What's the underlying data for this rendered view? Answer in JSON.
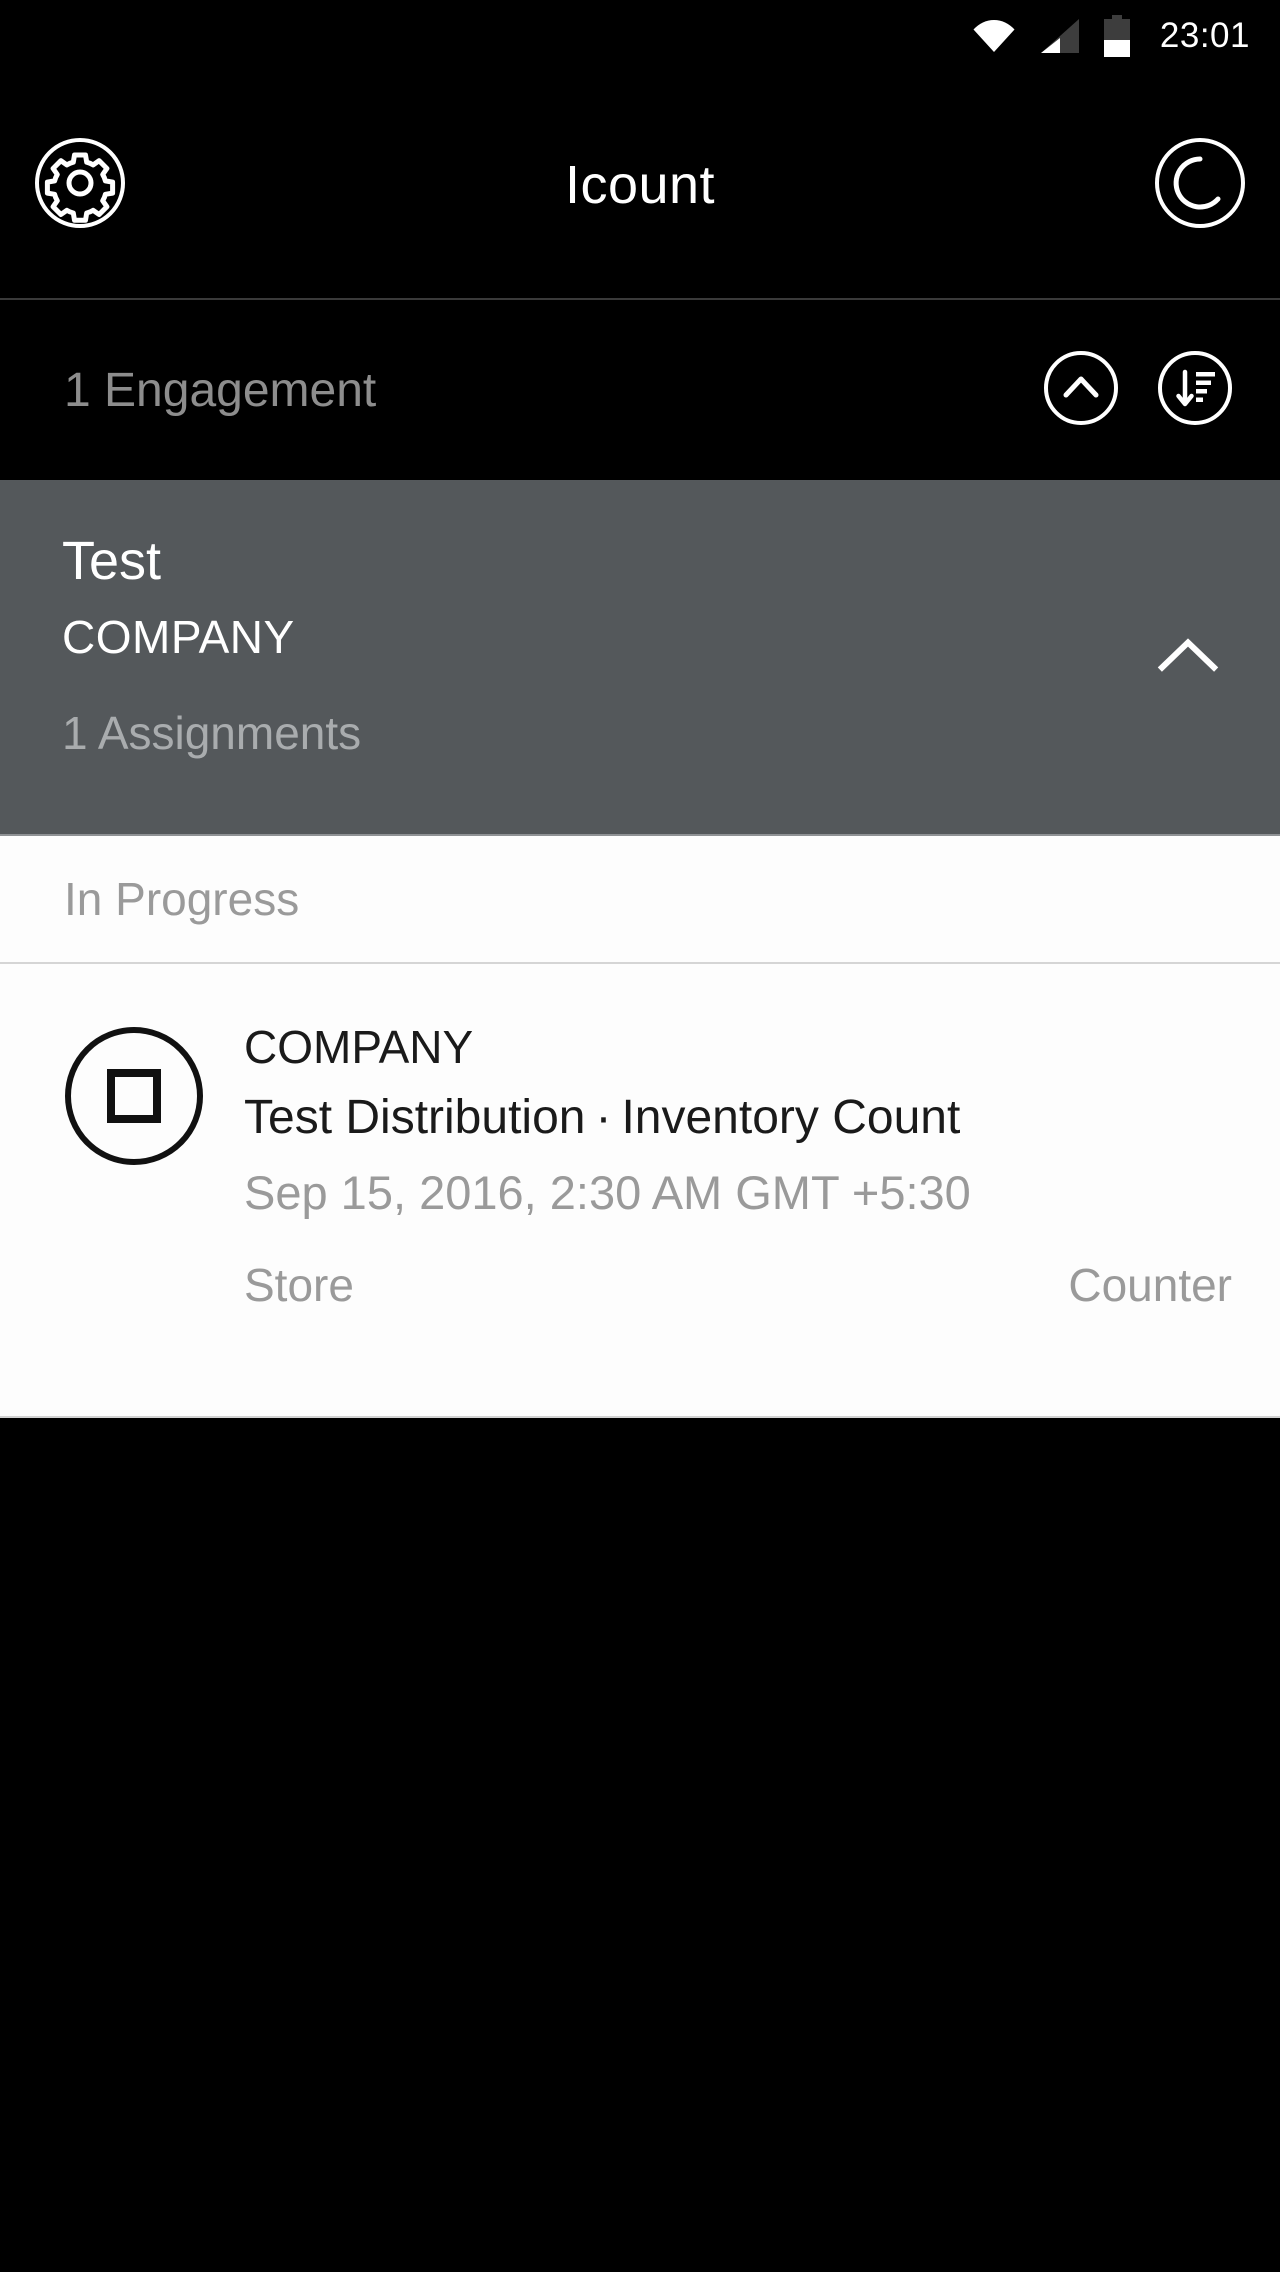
{
  "statusbar": {
    "time": "23:01",
    "icons": [
      "wifi-icon",
      "cellular-signal-icon",
      "battery-icon"
    ],
    "battery_level_percent": 45
  },
  "appbar": {
    "title": "Icount",
    "settings_icon": "gear-icon",
    "sync_icon": "sync-refresh-icon"
  },
  "engagement_header": {
    "count_label": "1 Engagement",
    "collapse_icon": "chevron-up-circle-icon",
    "sort_icon": "sort-descending-icon"
  },
  "engagement_card": {
    "title": "Test",
    "subtitle": "COMPANY",
    "assignments_label": "1 Assignments",
    "expand_icon": "chevron-up-icon",
    "background_color": "#54585b"
  },
  "section": {
    "label": "In Progress"
  },
  "assignment": {
    "status_icon": "stop-square-circle-icon",
    "company": "COMPANY",
    "distribution": "Test Distribution",
    "separator": "·",
    "count_type": "Inventory Count",
    "datetime": "Sep 15, 2016, 2:30 AM GMT +5:30",
    "location_label": "Store",
    "role_label": "Counter"
  },
  "colors": {
    "background": "#000000",
    "card_gray": "#54585b",
    "content_white": "#fdfdfd",
    "muted_text": "#9a9a9a",
    "primary_text": "#ffffff"
  }
}
